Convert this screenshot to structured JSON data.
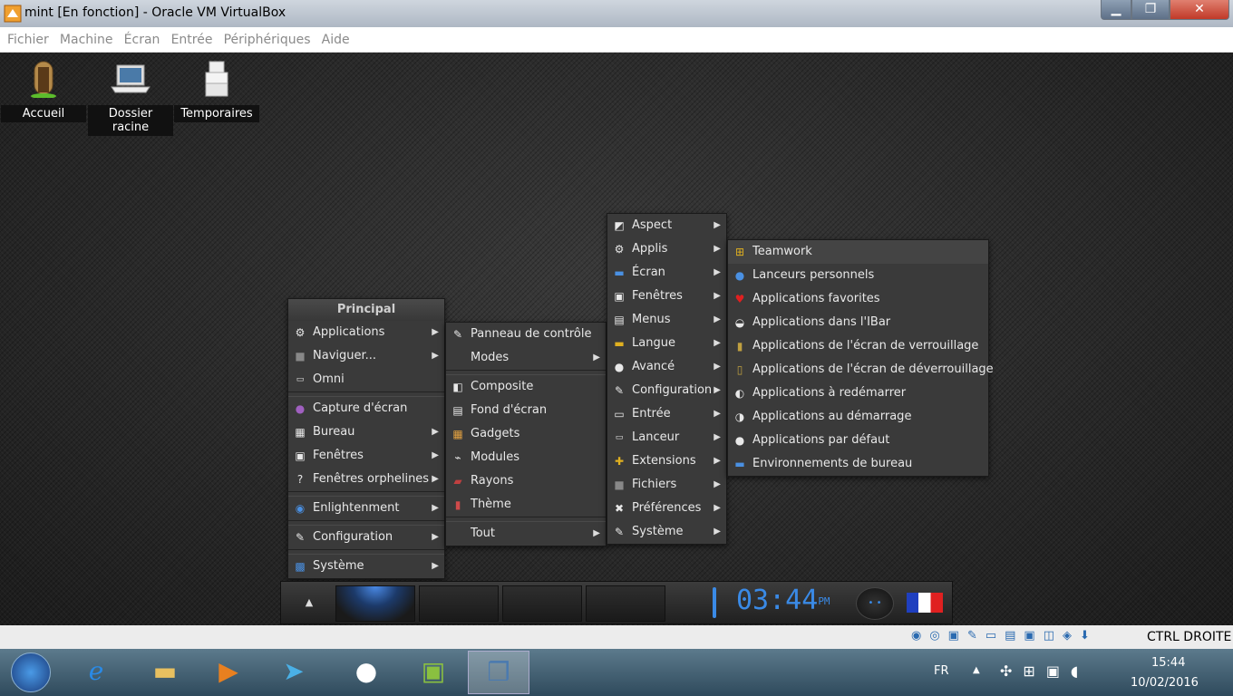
{
  "window": {
    "title": "mint [En fonction] - Oracle VM VirtualBox",
    "min": "▁",
    "max": "❐",
    "close": "✕"
  },
  "menubar": [
    "Fichier",
    "Machine",
    "Écran",
    "Entrée",
    "Périphériques",
    "Aide"
  ],
  "desktop_icons": [
    {
      "label": "Accueil",
      "icon": "home-door-icon"
    },
    {
      "label": "Dossier racine",
      "icon": "laptop-icon"
    },
    {
      "label": "Temporaires",
      "icon": "boxes-icon"
    }
  ],
  "main_menu": {
    "title": "Principal",
    "items": [
      {
        "label": "Applications",
        "icon": "gear-icon",
        "arrow": true
      },
      {
        "label": "Naviguer...",
        "icon": "folder-icon",
        "arrow": true
      },
      {
        "label": "Omni",
        "icon": "terminal-icon",
        "arrow": false
      },
      {
        "sep": true
      },
      {
        "label": "Capture d'écran",
        "icon": "camera-icon",
        "arrow": false
      },
      {
        "label": "Bureau",
        "icon": "desktop-grid-icon",
        "arrow": true
      },
      {
        "label": "Fenêtres",
        "icon": "window-icon",
        "arrow": true
      },
      {
        "label": "Fenêtres orphelines",
        "icon": "question-icon",
        "arrow": true
      },
      {
        "sep": true
      },
      {
        "label": "Enlightenment",
        "icon": "e-logo-icon",
        "arrow": true
      },
      {
        "sep": true
      },
      {
        "label": "Configuration",
        "icon": "wrench-icon",
        "arrow": true
      },
      {
        "sep": true
      },
      {
        "label": "Système",
        "icon": "system-icon",
        "arrow": true
      }
    ]
  },
  "config_menu": {
    "items": [
      {
        "label": "Panneau de contrôle",
        "icon": "wrench-icon",
        "arrow": false
      },
      {
        "label": "Modes",
        "icon": "",
        "arrow": true
      },
      {
        "sep": true
      },
      {
        "label": "Composite",
        "icon": "composite-icon",
        "arrow": false
      },
      {
        "label": "Fond d'écran",
        "icon": "wallpaper-icon",
        "arrow": false
      },
      {
        "label": "Gadgets",
        "icon": "gadgets-icon",
        "arrow": false
      },
      {
        "label": "Modules",
        "icon": "plug-icon",
        "arrow": false
      },
      {
        "label": "Rayons",
        "icon": "shelf-icon",
        "arrow": false
      },
      {
        "label": "Thème",
        "icon": "paint-icon",
        "arrow": false
      },
      {
        "sep": true
      },
      {
        "label": "Tout",
        "icon": "",
        "arrow": true
      }
    ]
  },
  "settings_menu": {
    "items": [
      {
        "label": "Aspect",
        "icon": "aspect-icon",
        "arrow": true
      },
      {
        "label": "Applis",
        "icon": "gear-icon",
        "arrow": true
      },
      {
        "label": "Écran",
        "icon": "screen-icon",
        "arrow": true
      },
      {
        "label": "Fenêtres",
        "icon": "window-icon",
        "arrow": true
      },
      {
        "label": "Menus",
        "icon": "menu-icon",
        "arrow": true
      },
      {
        "label": "Langue",
        "icon": "flag-icon",
        "arrow": true
      },
      {
        "label": "Avancé",
        "icon": "drop-icon",
        "arrow": true
      },
      {
        "label": "Configuration",
        "icon": "wrench-icon",
        "arrow": true
      },
      {
        "label": "Entrée",
        "icon": "keyboard-icon",
        "arrow": true
      },
      {
        "label": "Lanceur",
        "icon": "terminal-icon",
        "arrow": true
      },
      {
        "label": "Extensions",
        "icon": "puzzle-icon",
        "arrow": true
      },
      {
        "label": "Fichiers",
        "icon": "folder-icon",
        "arrow": true
      },
      {
        "label": "Préférences",
        "icon": "tools-icon",
        "arrow": true
      },
      {
        "label": "Système",
        "icon": "wrench-icon",
        "arrow": true
      }
    ]
  },
  "apps_menu": {
    "items": [
      {
        "label": "Teamwork",
        "icon": "teamwork-icon"
      },
      {
        "label": "Lanceurs personnels",
        "icon": "user-icon"
      },
      {
        "label": "Applications favorites",
        "icon": "heart-icon"
      },
      {
        "label": "Applications dans l'IBar",
        "icon": "ibar-icon"
      },
      {
        "label": "Applications de l'écran de verrouillage",
        "icon": "lock-icon"
      },
      {
        "label": "Applications de l'écran de déverrouillage",
        "icon": "unlock-icon"
      },
      {
        "label": "Applications à redémarrer",
        "icon": "restart-icon"
      },
      {
        "label": "Applications au démarrage",
        "icon": "startup-icon"
      },
      {
        "label": "Applications par défaut",
        "icon": "drop-icon"
      },
      {
        "label": "Environnements de bureau",
        "icon": "monitor-icon"
      }
    ]
  },
  "shelf": {
    "up": "▲",
    "clock": "03:44",
    "ampm": "PM"
  },
  "hostbar": {
    "label": "CTRL DROITE"
  },
  "taskbar": {
    "lang": "FR",
    "time": "15:44",
    "date": "10/02/2016"
  }
}
